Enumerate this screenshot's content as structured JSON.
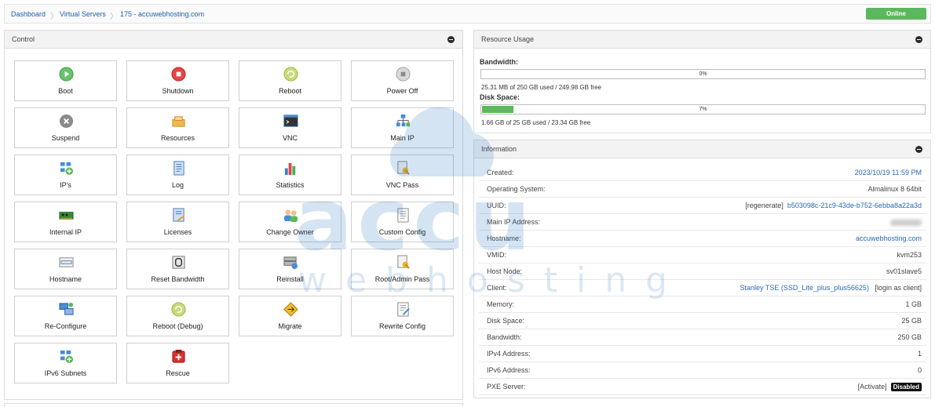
{
  "breadcrumb": {
    "items": [
      "Dashboard",
      "Virtual Servers",
      "175 - accuwebhosting.com"
    ],
    "separator": "〉"
  },
  "status": {
    "label": "Online",
    "color": "#5cb85c"
  },
  "control": {
    "title": "Control",
    "tiles": [
      {
        "label": "Boot",
        "icon": "play-icon"
      },
      {
        "label": "Shutdown",
        "icon": "stop-icon"
      },
      {
        "label": "Reboot",
        "icon": "reboot-icon"
      },
      {
        "label": "Power Off",
        "icon": "power-off-icon"
      },
      {
        "label": "Suspend",
        "icon": "suspend-icon"
      },
      {
        "label": "Resources",
        "icon": "resources-icon"
      },
      {
        "label": "VNC",
        "icon": "vnc-terminal-icon"
      },
      {
        "label": "Main IP",
        "icon": "network-icon"
      },
      {
        "label": "IP's",
        "icon": "add-ip-icon"
      },
      {
        "label": "Log",
        "icon": "notebook-icon"
      },
      {
        "label": "Statistics",
        "icon": "bar-chart-icon"
      },
      {
        "label": "VNC Pass",
        "icon": "key-document-icon"
      },
      {
        "label": "Internal IP",
        "icon": "network-card-icon"
      },
      {
        "label": "Licenses",
        "icon": "license-icon"
      },
      {
        "label": "Change Owner",
        "icon": "users-icon"
      },
      {
        "label": "Custom Config",
        "icon": "config-document-icon"
      },
      {
        "label": "Hostname",
        "icon": "hostname-icon"
      },
      {
        "label": "Reset Bandwidth",
        "icon": "reset-icon"
      },
      {
        "label": "Reinstall",
        "icon": "server-reinstall-icon"
      },
      {
        "label": "Root/Admin Pass",
        "icon": "root-key-icon"
      },
      {
        "label": "Re-Configure",
        "icon": "reconfigure-icon"
      },
      {
        "label": "Reboot (Debug)",
        "icon": "reboot-debug-icon"
      },
      {
        "label": "Migrate",
        "icon": "migrate-sign-icon"
      },
      {
        "label": "Rewrite Config",
        "icon": "rewrite-config-icon"
      },
      {
        "label": "IPv6 Subnets",
        "icon": "ipv6-subnet-icon"
      },
      {
        "label": "Rescue",
        "icon": "rescue-icon"
      }
    ]
  },
  "resource_usage": {
    "title": "Resource Usage",
    "bandwidth": {
      "label": "Bandwidth:",
      "percent_text": "0%",
      "percent": 0,
      "detail": "25.31 MB of 250 GB used / 249.98 GB free"
    },
    "disk": {
      "label": "Disk Space:",
      "percent_text": "7%",
      "percent": 7,
      "detail": "1.66 GB of 25 GB used / 23.34 GB free"
    }
  },
  "information": {
    "title": "Information",
    "rows": [
      {
        "key": "Created:",
        "value": "2023/10/19 11:59 PM"
      },
      {
        "key": "Operating System:",
        "value": "Almalinux 8 64bit"
      },
      {
        "key": "UUID:",
        "prefix": "[regenerate]",
        "value": "b503098c-21c9-43de-b752-6ebba8a22a3d"
      },
      {
        "key": "Main IP Address:",
        "value": ""
      },
      {
        "key": "Hostname:",
        "value": "accuwebhosting.com"
      },
      {
        "key": "VMID:",
        "value": "kvm253"
      },
      {
        "key": "Host Node:",
        "value": "sv01slave5"
      },
      {
        "key": "Client:",
        "value": "Stanley TSE (SSD_Lite_plus_plus56625)",
        "suffix": "[login as client]"
      },
      {
        "key": "Memory:",
        "value": "1 GB"
      },
      {
        "key": "Disk Space:",
        "value": "25 GB"
      },
      {
        "key": "Bandwidth:",
        "value": "250 GB"
      },
      {
        "key": "IPv4 Address:",
        "value": "1"
      },
      {
        "key": "IPv6 Address:",
        "value": "0"
      },
      {
        "key": "PXE Server:",
        "prefix": "[Activate]",
        "value": "Disabled"
      }
    ]
  },
  "watermark": {
    "brand": "accu",
    "sub": "webhosting"
  }
}
